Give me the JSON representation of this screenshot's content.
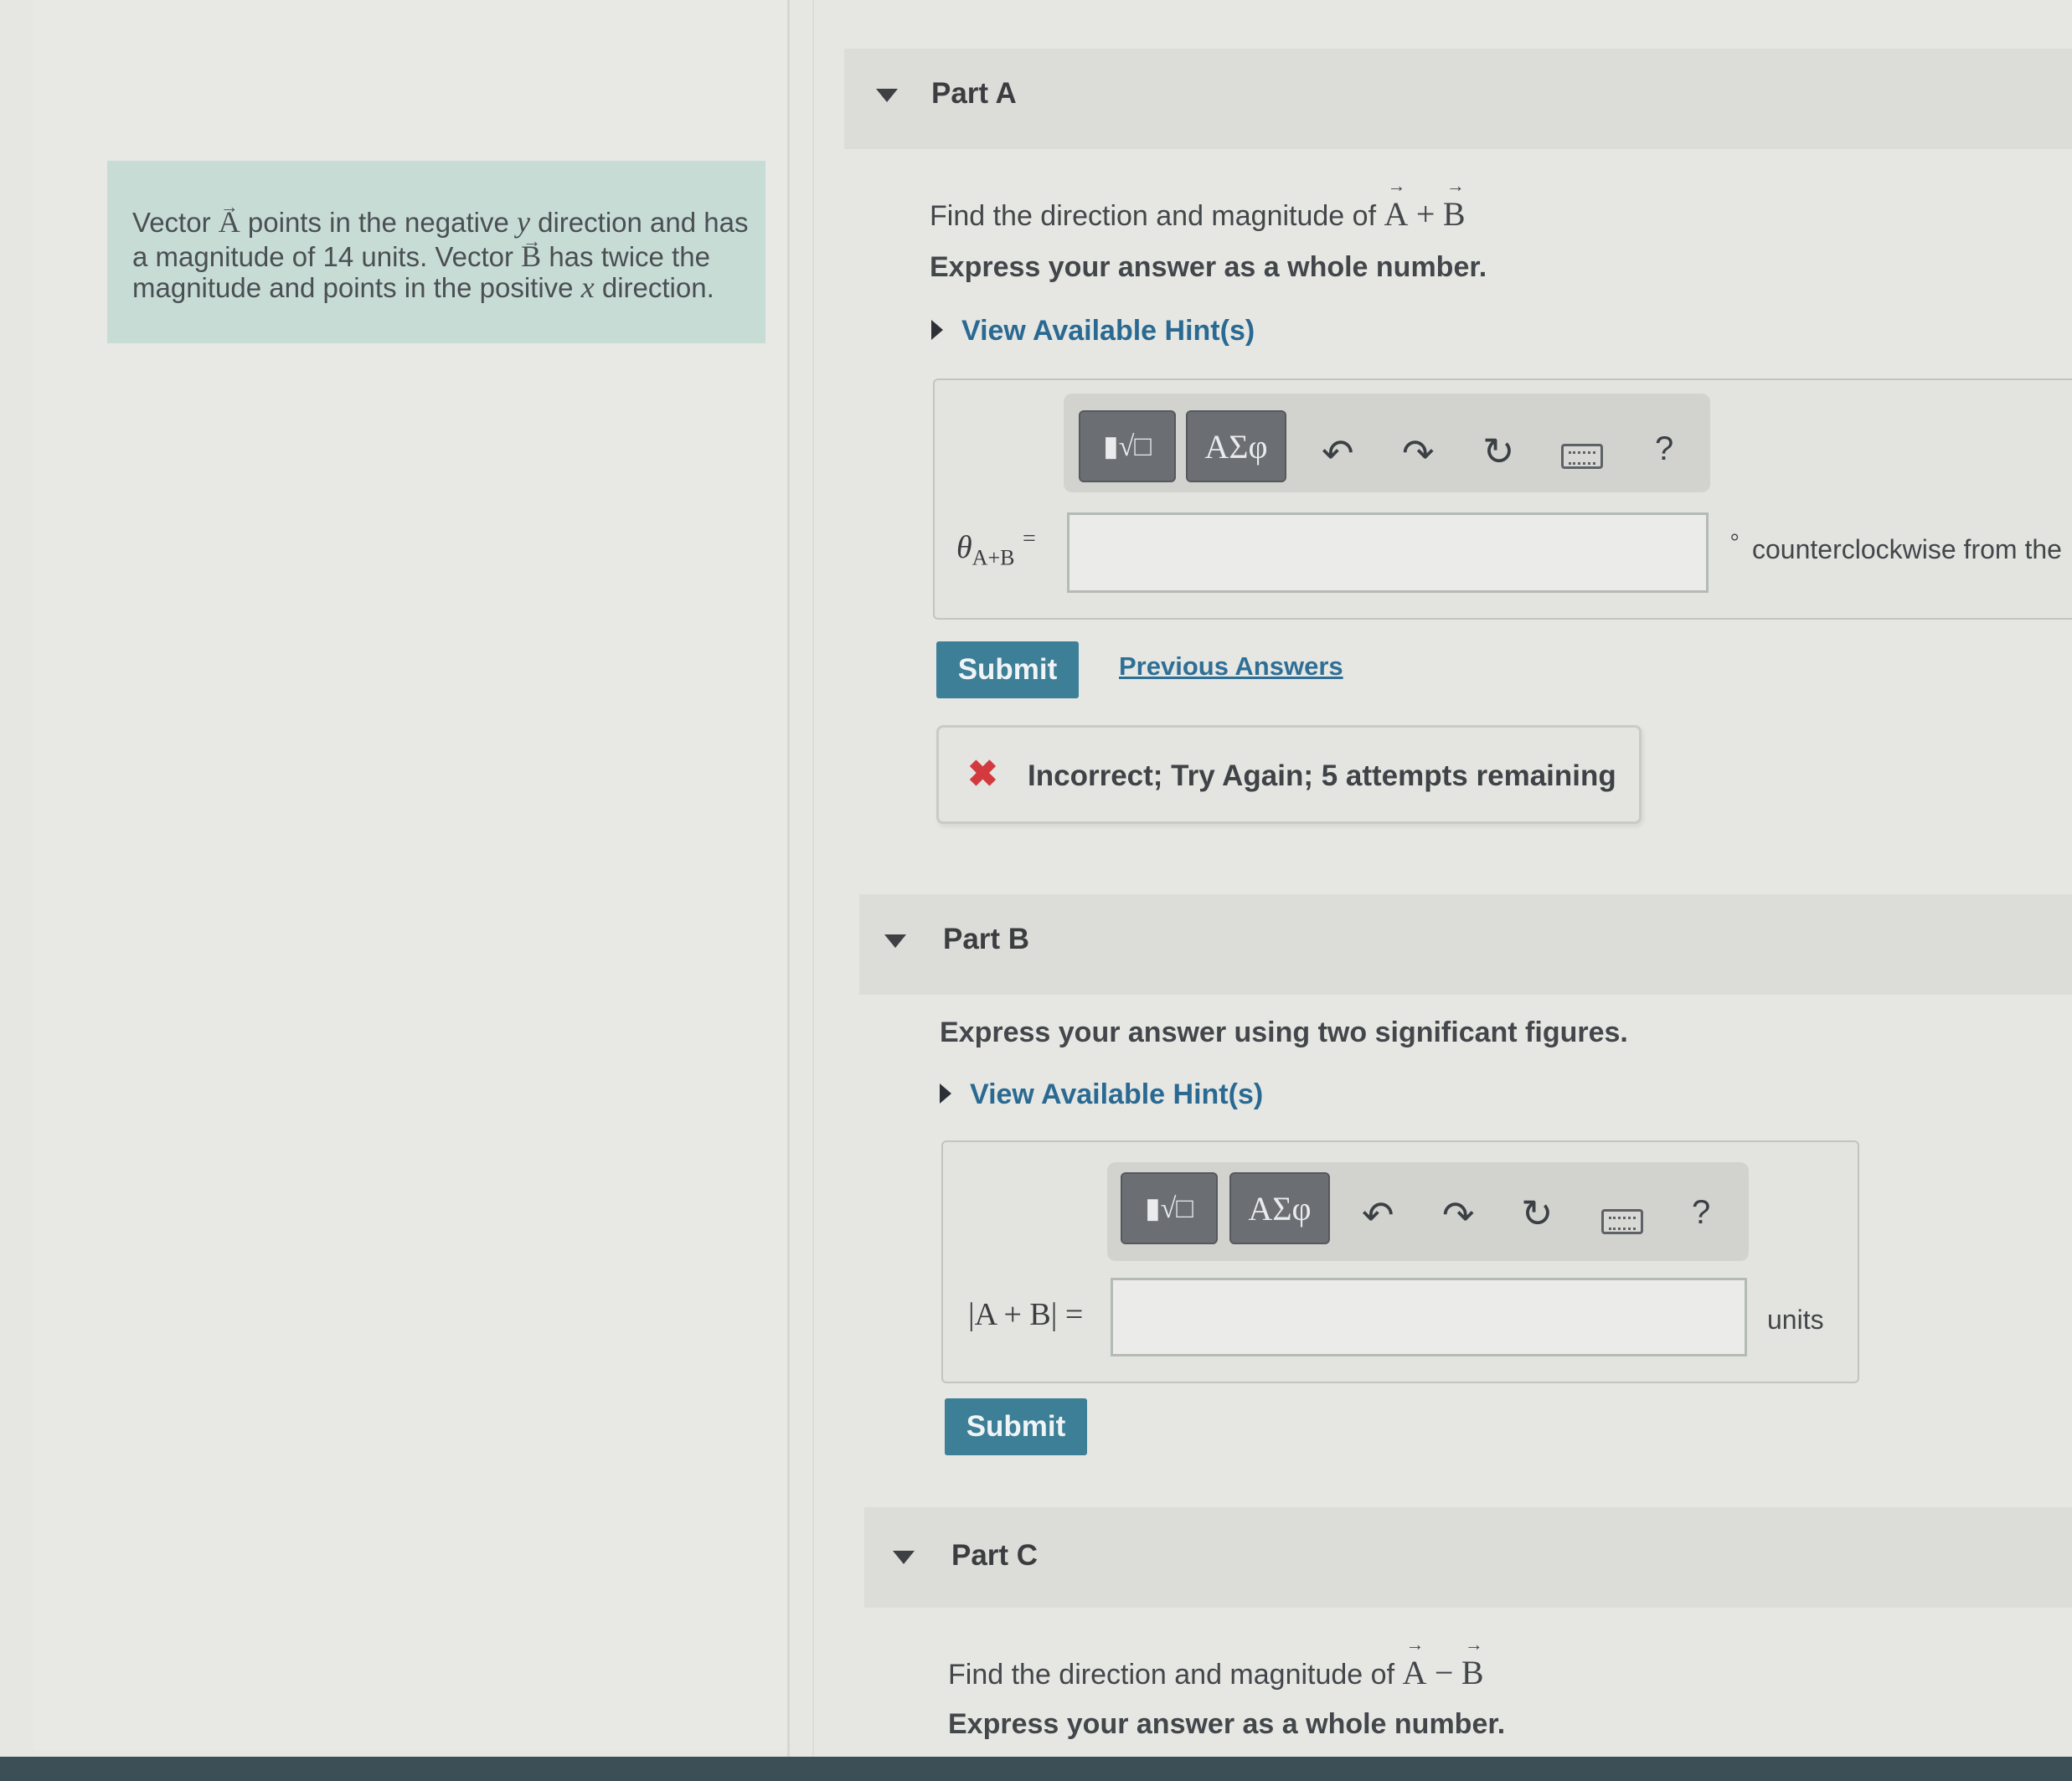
{
  "problem": {
    "statement_1": "Vector",
    "vec_a": "A",
    "statement_2": "points in the negative",
    "var_y": "y",
    "statement_3": "direction and has",
    "statement_4": "a magnitude of 14 units. Vector",
    "vec_b": "B",
    "statement_5": "has twice the",
    "statement_6": "magnitude and points in the positive",
    "var_x": "x",
    "statement_7": "direction."
  },
  "part_a": {
    "title": "Part A",
    "question_prefix": "Find the direction and magnitude of",
    "question_expr_a": "A",
    "question_op": "+",
    "question_expr_b": "B",
    "instruction": "Express your answer as a whole number.",
    "hint_label": "View Available Hint(s)",
    "toolbar": {
      "template_icon": "template-sqrt-icon",
      "symbols_label": "ΑΣφ",
      "help_label": "?"
    },
    "answer_label": "θ",
    "answer_sub": "A+B",
    "equals": "=",
    "input_value": "",
    "unit_degree": "°",
    "unit_text": "counterclockwise from the",
    "submit_label": "Submit",
    "previous_answers_label": "Previous Answers",
    "feedback": "Incorrect; Try Again; 5 attempts remaining"
  },
  "part_b": {
    "title": "Part B",
    "instruction": "Express your answer using two significant figures.",
    "hint_label": "View Available Hint(s)",
    "toolbar": {
      "template_icon": "template-sqrt-icon",
      "symbols_label": "ΑΣφ",
      "help_label": "?"
    },
    "answer_label": "|A + B| =",
    "input_value": "",
    "unit_text": "units",
    "submit_label": "Submit"
  },
  "part_c": {
    "title": "Part C",
    "question_prefix": "Find the direction and magnitude of",
    "question_expr_a": "A",
    "question_op": "−",
    "question_expr_b": "B",
    "instruction": "Express your answer as a whole number."
  }
}
